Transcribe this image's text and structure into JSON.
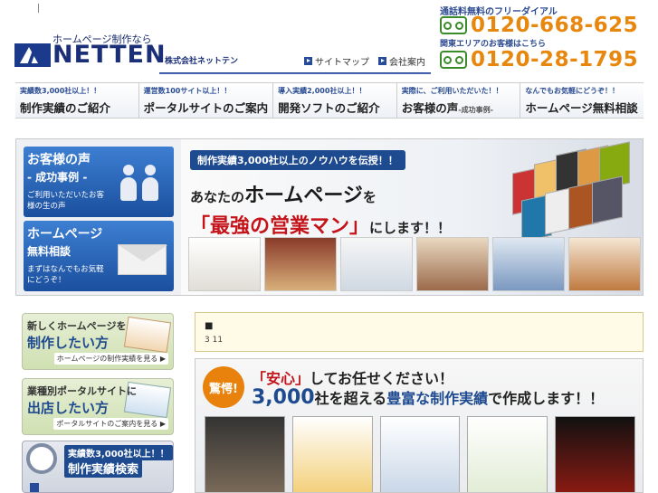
{
  "header": {
    "tagline": "ホームページ制作なら",
    "brand": "NETTEN",
    "company": "株式会社ネットテン",
    "links": [
      "サイトマップ",
      "会社案内"
    ],
    "free_dial_label": "通話料無料のフリーダイアル",
    "phone_main": "0120-668-625",
    "kanto_label": "関東エリアのお客様はこちら",
    "phone_kanto": "0120-28-1795",
    "colors": {
      "brand_blue": "#1b3a8c",
      "phone_orange": "#e8870e",
      "free_dial_green": "#3a8c2a"
    }
  },
  "nav": [
    {
      "sub": "実績数3,000社以上！！",
      "main": "制作実績のご紹介",
      "suffix": ""
    },
    {
      "sub": "運営数100サイト以上！！",
      "main": "ポータルサイトのご案内",
      "suffix": ""
    },
    {
      "sub": "導入実績2,000社以上！！",
      "main": "開発ソフトのご紹介",
      "suffix": ""
    },
    {
      "sub": "実際に、ご利用いただいた！！",
      "main": "お客様の声",
      "suffix": "-成功事例-"
    },
    {
      "sub": "なんでもお気軽にどうぞ！！",
      "main": "ホームページ無料相談",
      "suffix": ""
    }
  ],
  "hero": {
    "voice_card": {
      "title": "お客様の声",
      "sub": "- 成功事例 -",
      "desc": "ご利用いただいたお客様の生の声",
      "icon": "people-icon"
    },
    "consult_card": {
      "title": "ホームページ",
      "sub": "無料相談",
      "desc": "まずはなんでもお気軽にどうぞ！",
      "icon": "envelope-icon"
    },
    "ribbon": "制作実績3,000社以上のノウハウを伝授！！",
    "line1_pre": "あなたの",
    "line1_big": "ホームページ",
    "line1_post": "を",
    "line2_big": "「最強の営業マン」",
    "line2_post": "にします！！"
  },
  "left_boxes": [
    {
      "title": "新しくホームページを",
      "big": "制作したい方",
      "link": "ホームページの制作実績を見る ▶"
    },
    {
      "title": "業種別ポータルサイトに",
      "big": "出店したい方",
      "link": "ポータルサイトのご案内を見る ▶"
    }
  ],
  "search_box": {
    "sub": "実績数3,000社以上！！",
    "title": "制作実績検索",
    "icon": "magnifier-icon"
  },
  "news": {
    "marker": "■",
    "date": "3 11"
  },
  "main_banner": {
    "badge": "驚愕!",
    "line1_pre": "「安心」",
    "line1_post": "してお任せください！",
    "line2_num": "3,000",
    "line2_mid": "社を超える",
    "line2_hl": "豊富な制作実績",
    "line2_post": "で作成します！！"
  }
}
